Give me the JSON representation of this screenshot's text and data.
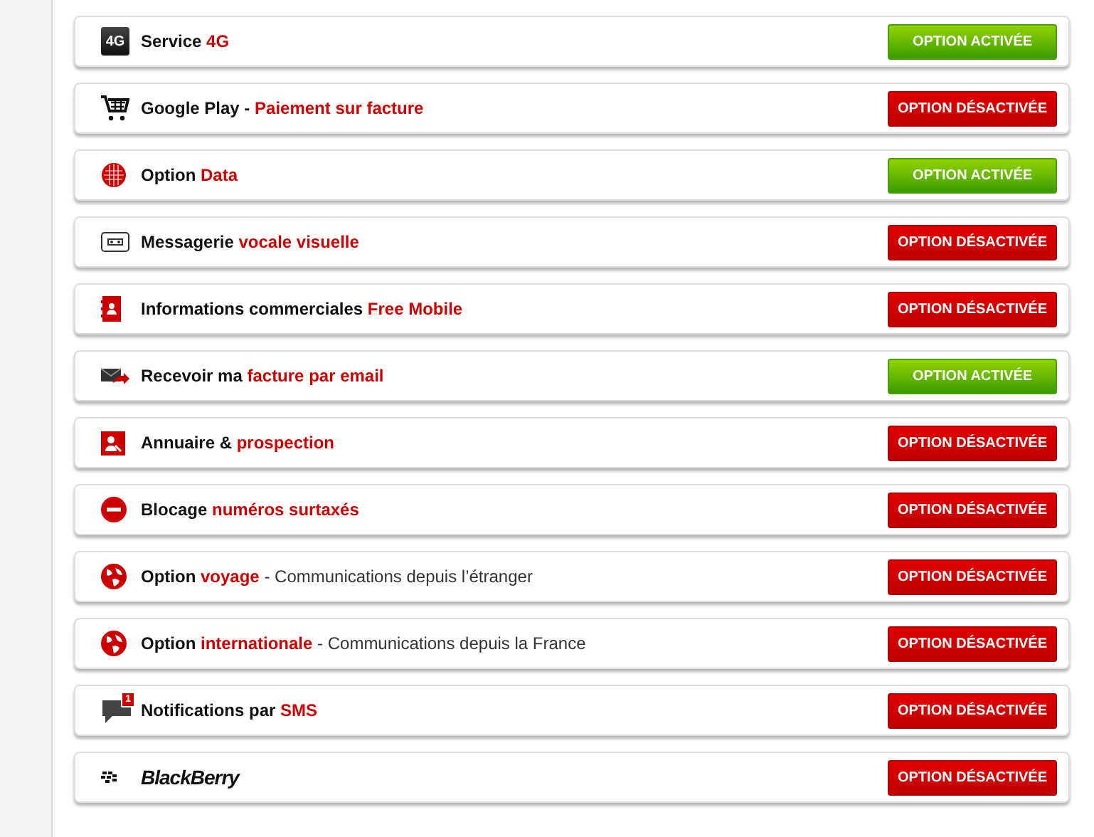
{
  "options": [
    {
      "kind": "network",
      "icon_text": "4G",
      "title": [
        {
          "kind": "dark",
          "text": "Service "
        },
        {
          "kind": "red",
          "text": "4G"
        }
      ],
      "button": {
        "label": "OPTION ACTIVÉE",
        "on": true
      }
    },
    {
      "kind": "cart",
      "title": [
        {
          "kind": "dark",
          "text": "Google Play - "
        },
        {
          "kind": "red",
          "text": "Paiement sur facture"
        }
      ],
      "button": {
        "label": "OPTION DÉSACTIVÉE",
        "on": false
      }
    },
    {
      "kind": "data",
      "title": [
        {
          "kind": "dark",
          "text": "Option "
        },
        {
          "kind": "red",
          "text": "Data"
        }
      ],
      "button": {
        "label": "OPTION ACTIVÉE",
        "on": true
      }
    },
    {
      "kind": "voicemail",
      "title": [
        {
          "kind": "dark",
          "text": "Messagerie "
        },
        {
          "kind": "red",
          "text": "vocale visuelle"
        }
      ],
      "button": {
        "label": "OPTION DÉSACTIVÉE",
        "on": false
      }
    },
    {
      "kind": "contacts",
      "title": [
        {
          "kind": "dark",
          "text": "Informations commerciales "
        },
        {
          "kind": "red",
          "text": "Free Mobile"
        }
      ],
      "button": {
        "label": "OPTION DÉSACTIVÉE",
        "on": false
      }
    },
    {
      "kind": "mail",
      "title": [
        {
          "kind": "dark",
          "text": "Recevoir ma "
        },
        {
          "kind": "red",
          "text": "facture par email"
        }
      ],
      "button": {
        "label": "OPTION ACTIVÉE",
        "on": true
      }
    },
    {
      "kind": "directory",
      "title": [
        {
          "kind": "dark",
          "text": "Annuaire & "
        },
        {
          "kind": "red",
          "text": "prospection"
        }
      ],
      "button": {
        "label": "OPTION DÉSACTIVÉE",
        "on": false
      }
    },
    {
      "kind": "blocked",
      "title": [
        {
          "kind": "dark",
          "text": "Blocage "
        },
        {
          "kind": "red",
          "text": "numéros surtaxés"
        }
      ],
      "button": {
        "label": "OPTION DÉSACTIVÉE",
        "on": false
      }
    },
    {
      "kind": "globe",
      "title": [
        {
          "kind": "dark",
          "text": "Option "
        },
        {
          "kind": "red",
          "text": "voyage"
        },
        {
          "kind": "light",
          "text": " - Communications depuis l’étranger"
        }
      ],
      "button": {
        "label": "OPTION DÉSACTIVÉE",
        "on": false
      }
    },
    {
      "kind": "globe",
      "title": [
        {
          "kind": "dark",
          "text": "Option "
        },
        {
          "kind": "red",
          "text": "internationale"
        },
        {
          "kind": "light",
          "text": " - Communications depuis la France"
        }
      ],
      "button": {
        "label": "OPTION DÉSACTIVÉE",
        "on": false
      }
    },
    {
      "kind": "sms",
      "icon_text": "1",
      "title": [
        {
          "kind": "dark",
          "text": "Notifications par "
        },
        {
          "kind": "red",
          "text": "SMS"
        }
      ],
      "button": {
        "label": "OPTION DÉSACTIVÉE",
        "on": false
      }
    },
    {
      "kind": "logo",
      "title": [
        {
          "kind": "logo",
          "text": "BlackBerry"
        }
      ],
      "button": {
        "label": "OPTION DÉSACTIVÉE",
        "on": false
      }
    }
  ]
}
